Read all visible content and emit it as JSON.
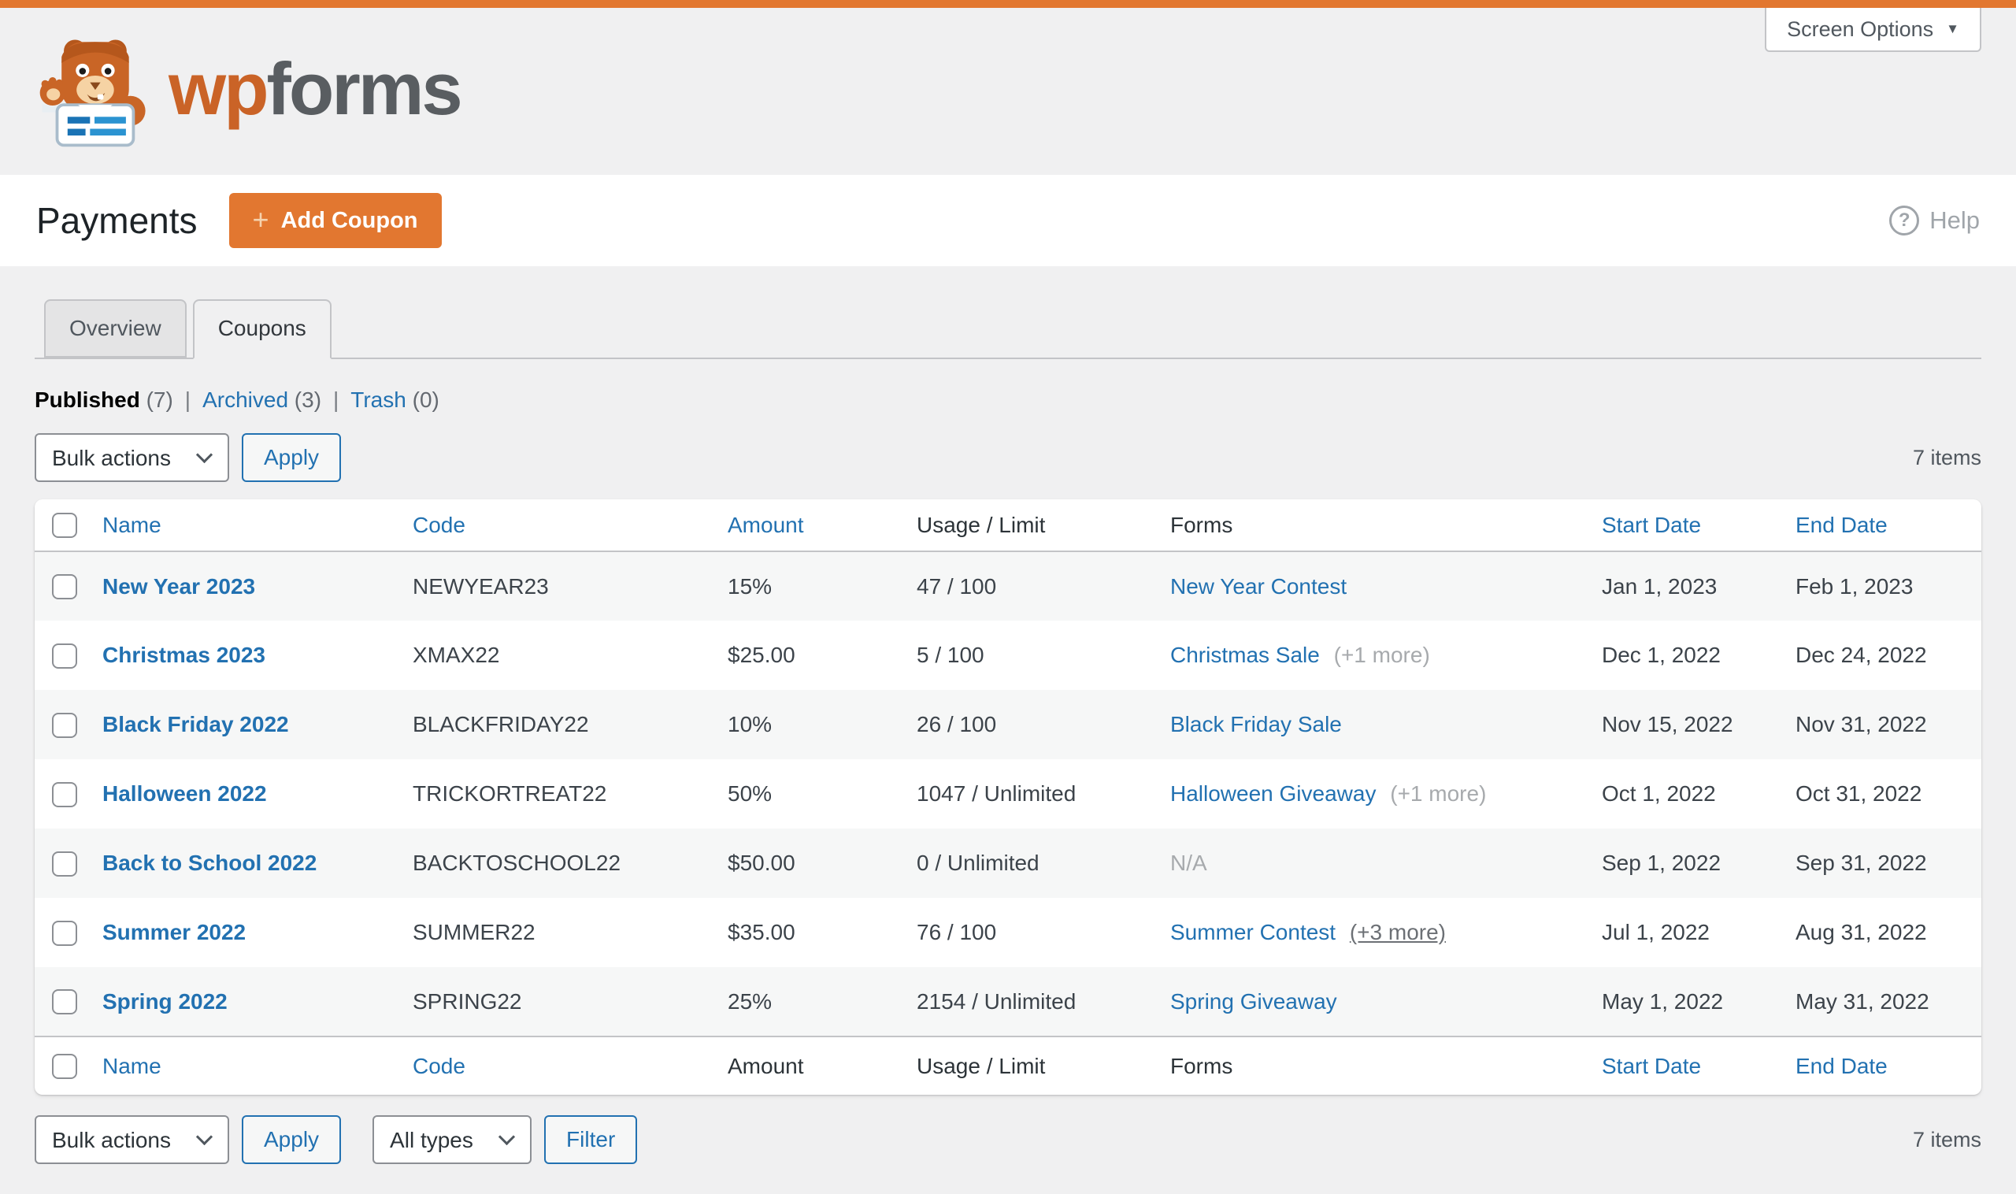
{
  "screen_options": {
    "label": "Screen Options"
  },
  "brand": {
    "wordmark_primary": "wp",
    "wordmark_secondary": "forms"
  },
  "page_header": {
    "title": "Payments",
    "add_coupon_label": "Add Coupon",
    "help_label": "Help"
  },
  "tabs": [
    {
      "label": "Overview",
      "active": false
    },
    {
      "label": "Coupons",
      "active": true
    }
  ],
  "filters": [
    {
      "label": "Published",
      "count": "(7)",
      "current": true
    },
    {
      "label": "Archived",
      "count": "(3)",
      "current": false
    },
    {
      "label": "Trash",
      "count": "(0)",
      "current": false
    }
  ],
  "toolbar_top": {
    "bulk_actions_value": "Bulk actions",
    "apply_label": "Apply",
    "items_count": "7 items"
  },
  "toolbar_bottom": {
    "bulk_actions_value": "Bulk actions",
    "apply_label": "Apply",
    "type_filter_value": "All types",
    "filter_label": "Filter",
    "items_count": "7 items"
  },
  "table": {
    "columns": [
      {
        "key": "name",
        "label": "Name",
        "header_link": true,
        "footer_link": true
      },
      {
        "key": "code",
        "label": "Code",
        "header_link": true,
        "footer_link": true
      },
      {
        "key": "amount",
        "label": "Amount",
        "header_link": true,
        "footer_link": false
      },
      {
        "key": "usage",
        "label": "Usage / Limit",
        "header_link": false,
        "footer_link": false
      },
      {
        "key": "forms",
        "label": "Forms",
        "header_link": false,
        "footer_link": false
      },
      {
        "key": "start",
        "label": "Start Date",
        "header_link": true,
        "footer_link": true
      },
      {
        "key": "end",
        "label": "End Date",
        "header_link": true,
        "footer_link": true
      }
    ],
    "rows": [
      {
        "name": "New Year 2023",
        "code": "NEWYEAR23",
        "amount": "15%",
        "usage": "47 / 100",
        "form_link": "New Year Contest",
        "form_extra": "",
        "form_extra_underline": false,
        "form_na": "",
        "start": "Jan 1, 2023",
        "end": "Feb 1, 2023"
      },
      {
        "name": "Christmas 2023",
        "code": "XMAX22",
        "amount": "$25.00",
        "usage": "5 / 100",
        "form_link": "Christmas Sale",
        "form_extra": "(+1 more)",
        "form_extra_underline": false,
        "form_na": "",
        "start": "Dec 1, 2022",
        "end": "Dec 24, 2022"
      },
      {
        "name": "Black Friday 2022",
        "code": "BLACKFRIDAY22",
        "amount": "10%",
        "usage": "26 / 100",
        "form_link": "Black Friday Sale",
        "form_extra": "",
        "form_extra_underline": false,
        "form_na": "",
        "start": "Nov 15, 2022",
        "end": "Nov 31, 2022"
      },
      {
        "name": "Halloween 2022",
        "code": "TRICKORTREAT22",
        "amount": "50%",
        "usage": "1047 / Unlimited",
        "form_link": "Halloween Giveaway",
        "form_extra": "(+1 more)",
        "form_extra_underline": false,
        "form_na": "",
        "start": "Oct 1, 2022",
        "end": "Oct 31, 2022"
      },
      {
        "name": "Back to School 2022",
        "code": "BACKTOSCHOOL22",
        "amount": "$50.00",
        "usage": "0 / Unlimited",
        "form_link": "",
        "form_extra": "",
        "form_extra_underline": false,
        "form_na": "N/A",
        "start": "Sep 1, 2022",
        "end": "Sep 31, 2022"
      },
      {
        "name": "Summer 2022",
        "code": "SUMMER22",
        "amount": "$35.00",
        "usage": "76 / 100",
        "form_link": "Summer Contest",
        "form_extra": "(+3 more)",
        "form_extra_underline": true,
        "form_na": "",
        "start": "Jul 1, 2022",
        "end": "Aug 31, 2022"
      },
      {
        "name": "Spring 2022",
        "code": "SPRING22",
        "amount": "25%",
        "usage": "2154 / Unlimited",
        "form_link": "Spring Giveaway",
        "form_extra": "",
        "form_extra_underline": false,
        "form_na": "",
        "start": "May 1, 2022",
        "end": "May 31, 2022"
      }
    ]
  },
  "colors": {
    "accent_orange": "#e27730",
    "link_blue": "#2271b1",
    "page_background": "#f0f0f1",
    "row_alt_background": "#f6f7f7",
    "muted_gray": "#a7aaad"
  }
}
